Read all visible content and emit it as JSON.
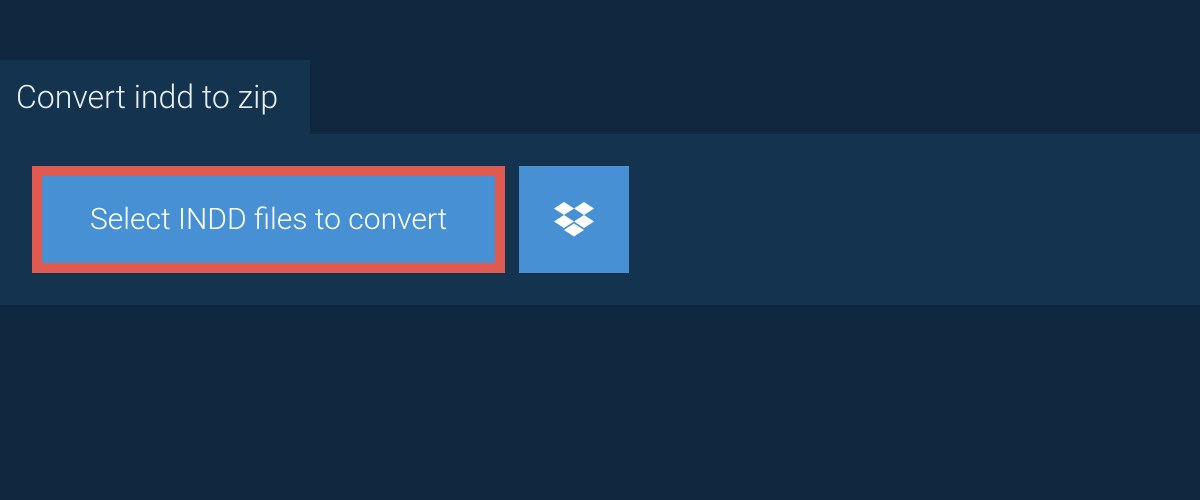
{
  "header": {
    "title": "Convert indd to zip"
  },
  "actions": {
    "select_label": "Select INDD files to convert"
  },
  "colors": {
    "background": "#0f2840",
    "panel": "#14334f",
    "button": "#4890d4",
    "highlight_border": "#df5b52",
    "text": "#ffffff"
  }
}
